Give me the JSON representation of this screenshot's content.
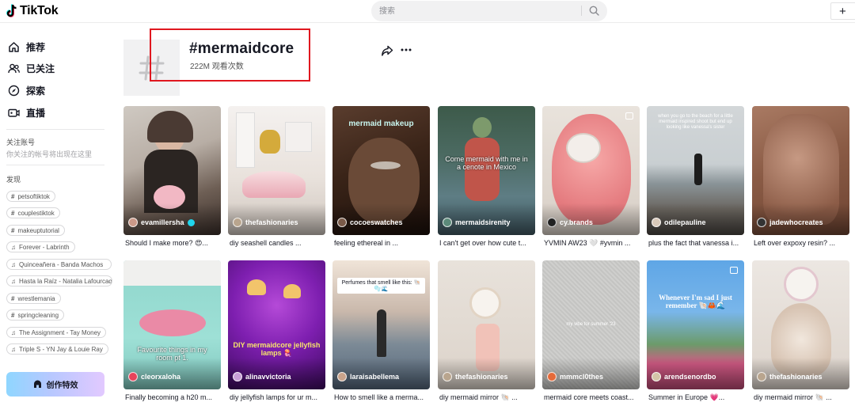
{
  "header": {
    "logo_text": "TikTok",
    "search_placeholder": "搜索",
    "upload_label": "+"
  },
  "sidebar": {
    "nav": [
      {
        "label": "推荐",
        "icon": "home-icon"
      },
      {
        "label": "已关注",
        "icon": "following-icon"
      },
      {
        "label": "探索",
        "icon": "compass-icon"
      },
      {
        "label": "直播",
        "icon": "live-icon"
      }
    ],
    "following_title": "关注账号",
    "following_hint": "你关注的帐号将出现在这里",
    "discover_title": "发现",
    "discover_tags": [
      {
        "label": "petsoftiktok",
        "type": "hashtag"
      },
      {
        "label": "couplestiktok",
        "type": "hashtag"
      },
      {
        "label": "makeuptutorial",
        "type": "hashtag"
      },
      {
        "label": "Forever - Labrinth",
        "type": "music"
      },
      {
        "label": "Quinceañera - Banda Machos",
        "type": "music"
      },
      {
        "label": "Hasta la Raíz - Natalia Lafourcade",
        "type": "music"
      },
      {
        "label": "wrestlemania",
        "type": "hashtag"
      },
      {
        "label": "springcleaning",
        "type": "hashtag"
      },
      {
        "label": "The Assignment - Tay Money",
        "type": "music"
      },
      {
        "label": "Triple S - YN Jay & Louie Ray",
        "type": "music"
      }
    ],
    "effects_label": "创作特效"
  },
  "hashtag": {
    "title": "#mermaidcore",
    "views": "222M 观看次数"
  },
  "videos": [
    {
      "author": "evamillersha",
      "verified": true,
      "caption": "Should I make more? 😍...",
      "overlay": ""
    },
    {
      "author": "thefashionaries",
      "verified": false,
      "caption": "diy seashell candles ...",
      "overlay": ""
    },
    {
      "author": "cocoeswatches",
      "verified": false,
      "caption": "feeling ethereal in ...",
      "overlay": "mermaid makeup"
    },
    {
      "author": "mermaidsirenity",
      "verified": false,
      "caption": "I can't get over how cute t...",
      "overlay": "Come mermaid with me in a cenote in Mexico"
    },
    {
      "author": "cy.brands",
      "verified": false,
      "caption": "YVMIN AW23 🤍 #yvmin ...",
      "overlay": ""
    },
    {
      "author": "odilepauline",
      "verified": false,
      "caption": "plus the fact that vanessa i...",
      "overlay": "when you go to the beach for a little mermaid inspired shoot but end up looking like vanessa's sister"
    },
    {
      "author": "jadewhocreates",
      "verified": false,
      "caption": "Left over expoxy resin? ...",
      "overlay": ""
    },
    {
      "author": "cleorxaloha",
      "verified": false,
      "caption": "Finally becoming a h20 m...",
      "overlay": "Favourite things in my room pt 1."
    },
    {
      "author": "alinavvictoria",
      "verified": false,
      "caption": "diy jellyfish lamps for ur m...",
      "overlay": "DIY mermaidcore jellyfish lamps 🪼"
    },
    {
      "author": "laraisabellema",
      "verified": false,
      "caption": "How to smell like a merma...",
      "overlay": "Perfumes that smell like this: 🐚🫧🌊"
    },
    {
      "author": "thefashionaries",
      "verified": false,
      "caption": "diy mermaid mirror 🐚 ...",
      "overlay": ""
    },
    {
      "author": "mmmcl0thes",
      "verified": false,
      "caption": "mermaid core meets coast...",
      "overlay": "my vibe for summer '23"
    },
    {
      "author": "arendsenordbo",
      "verified": false,
      "caption": "Summer in Europe 💗...",
      "overlay": "Whenever I'm sad I just remember 🐚🦀🌊"
    },
    {
      "author": "thefashionaries",
      "verified": false,
      "caption": "diy mermaid mirror 🐚 ...",
      "overlay": ""
    }
  ],
  "colors": {
    "highlight": "#e0171f",
    "text_primary": "#161823",
    "search_bg": "#f1f1f2"
  }
}
